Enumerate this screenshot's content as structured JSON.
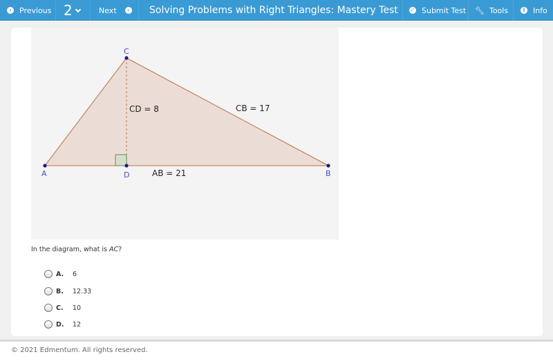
{
  "topbar": {
    "previous_label": "Previous",
    "page_number": "2",
    "next_label": "Next",
    "title": "Solving Problems with Right Triangles: Mastery Test",
    "submit_label": "Submit Test",
    "tools_label": "Tools",
    "info_label": "Info"
  },
  "diagram": {
    "points": {
      "A": "A",
      "B": "B",
      "C": "C",
      "D": "D"
    },
    "labels": {
      "cd": "CD = 8",
      "cb": "CB = 17",
      "ab": "AB = 21"
    },
    "colors": {
      "fill": "#ecdcd6",
      "stroke": "#c08a6a",
      "point": "#1a1a8c",
      "point_label": "#4a4ad0",
      "right_angle": "#d7dccb"
    }
  },
  "question": {
    "prefix": "In the diagram, what is ",
    "var": "AC",
    "suffix": "?"
  },
  "options": [
    {
      "letter": "A.",
      "value": "6"
    },
    {
      "letter": "B.",
      "value": "12.33"
    },
    {
      "letter": "C.",
      "value": "10"
    },
    {
      "letter": "D.",
      "value": "12"
    }
  ],
  "footer": {
    "copyright": "© 2021 Edmentum. All rights reserved."
  }
}
